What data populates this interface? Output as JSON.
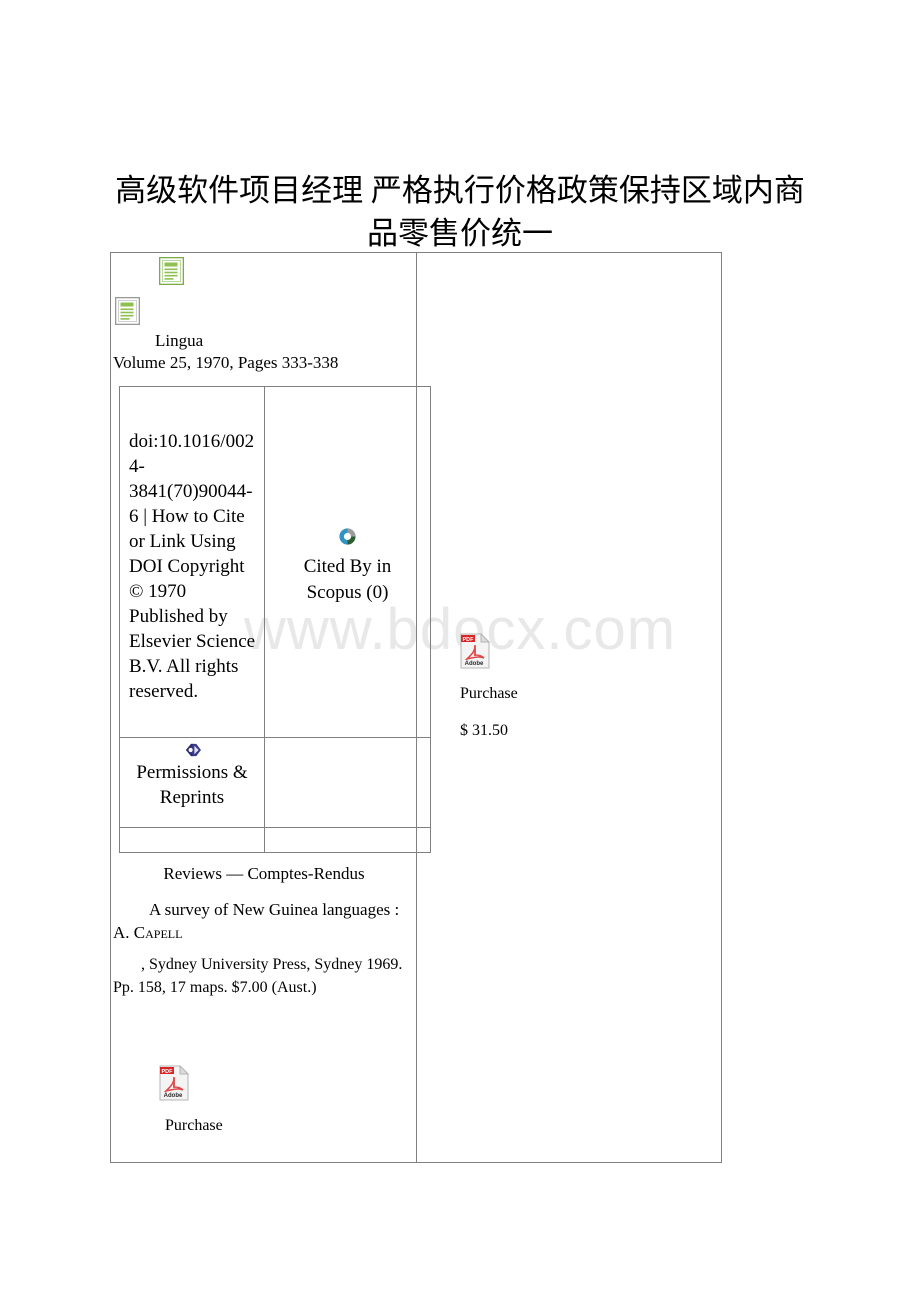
{
  "page": {
    "title": "高级软件项目经理 严格执行价格政策保持区域内商品零售价统一",
    "watermark": "www.bdocx.com"
  },
  "journal": {
    "name": "Lingua",
    "volume_line": "Volume 25, 1970, Pages 333-338",
    "doc_icon_1": "document-icon",
    "doc_icon_2": "document-icon"
  },
  "info_table": {
    "doi_cell": "doi:10.1016/0024-3841(70)90044-6 | How to Cite or Link Using DOI Copyright © 1970 Published by Elsevier Science B.V. All rights reserved.",
    "scopus_label": "Cited By in Scopus (0)",
    "scopus_icon": "scopus-ring-icon",
    "permissions_label": "Permissions & Reprints",
    "permissions_icon": "permissions-chevron-icon"
  },
  "article": {
    "section": "Reviews — Comptes-Rendus",
    "title": "A survey of New Guinea languages :",
    "author": "A. Capell",
    "meta": ", Sydney University Press, Sydney 1969. Pp. 158, 17 maps. $7.00 (Aust.)"
  },
  "purchase_left": {
    "icon": "adobe-pdf-icon",
    "label": "Purchase"
  },
  "purchase_right": {
    "icon": "adobe-pdf-icon",
    "label": "Purchase",
    "price": "$ 31.50"
  }
}
